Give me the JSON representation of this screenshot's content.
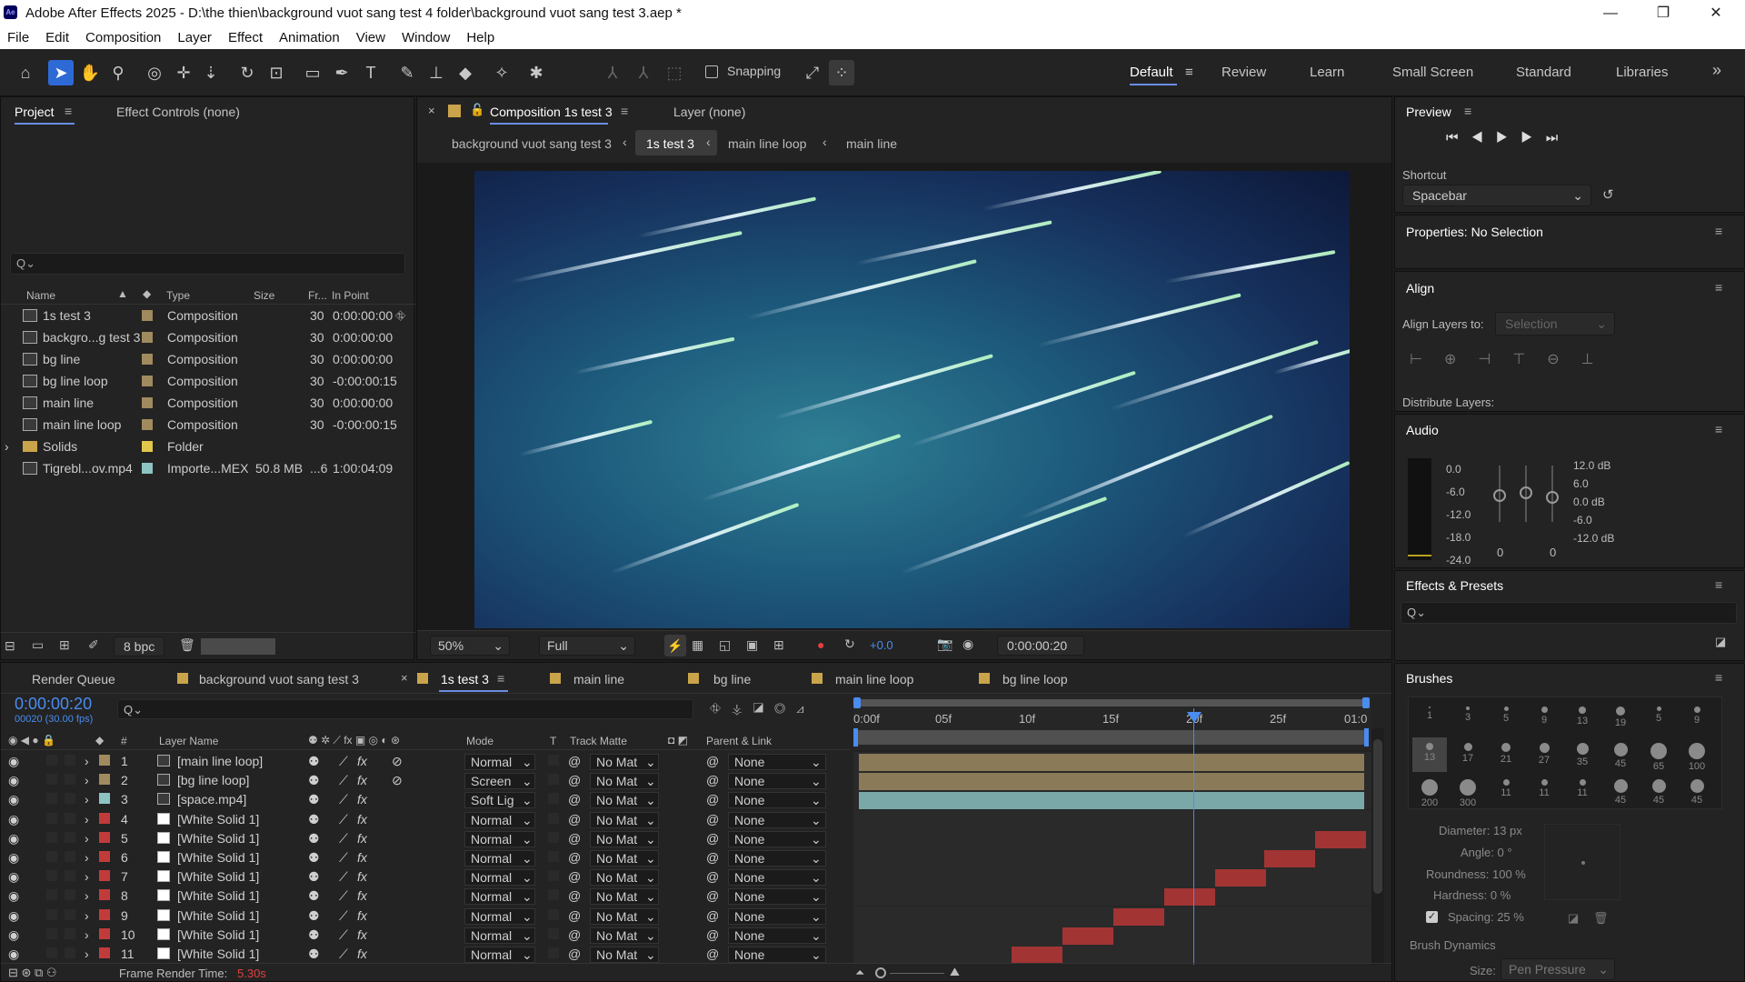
{
  "window": {
    "title": "Adobe After Effects 2025 - D:\\the thien\\background vuot sang test 4 folder\\background vuot sang test 3.aep *",
    "app_icon": "Ae"
  },
  "window_controls": {
    "minimize": "—",
    "maximize": "❐",
    "close": "✕"
  },
  "menu": [
    "File",
    "Edit",
    "Composition",
    "Layer",
    "Effect",
    "Animation",
    "View",
    "Window",
    "Help"
  ],
  "toolbar": {
    "snapping": "Snapping",
    "workspaces": [
      "Default",
      "Review",
      "Learn",
      "Small Screen",
      "Standard",
      "Libraries"
    ],
    "more": "»"
  },
  "project": {
    "tab": "Project",
    "tab2": "Effect Controls (none)",
    "search_placeholder": "Q⌄",
    "columns": [
      "Name",
      "Type",
      "Size",
      "Fr...",
      "In Point"
    ],
    "items": [
      {
        "name": "1s test 3",
        "type": "Composition",
        "size": "",
        "fr": "30",
        "in": "0:00:00:00",
        "color": "#a08a5e"
      },
      {
        "name": "backgro...g test 3",
        "type": "Composition",
        "size": "",
        "fr": "30",
        "in": "0:00:00:00",
        "color": "#a08a5e"
      },
      {
        "name": "bg line",
        "type": "Composition",
        "size": "",
        "fr": "30",
        "in": "0:00:00:00",
        "color": "#a08a5e"
      },
      {
        "name": "bg line loop",
        "type": "Composition",
        "size": "",
        "fr": "30",
        "in": "-0:00:00:15",
        "color": "#a08a5e"
      },
      {
        "name": "main line",
        "type": "Composition",
        "size": "",
        "fr": "30",
        "in": "0:00:00:00",
        "color": "#a08a5e"
      },
      {
        "name": "main line loop",
        "type": "Composition",
        "size": "",
        "fr": "30",
        "in": "-0:00:00:15",
        "color": "#a08a5e"
      },
      {
        "name": "Solids",
        "type": "Folder",
        "size": "",
        "fr": "",
        "in": "",
        "color": "#e2c84a"
      },
      {
        "name": "Tigrebl...ov.mp4",
        "type": "Importe...MEX",
        "size": "50.8 MB",
        "fr": "...6",
        "in": "1:00:04:09",
        "color": "#8ec3c3"
      }
    ],
    "bpc": "8 bpc"
  },
  "composition": {
    "tab": "Composition 1s test 3",
    "layer_tab": "Layer (none)",
    "breadcrumbs": [
      "background vuot sang test 3",
      "1s test 3",
      "main line loop",
      "main line"
    ],
    "zoom": "50%",
    "resolution": "Full",
    "exposure": "+0.0",
    "timecode": "0:00:00:20"
  },
  "preview": {
    "title": "Preview",
    "shortcut_label": "Shortcut",
    "shortcut": "Spacebar"
  },
  "properties": {
    "title": "Properties: No Selection"
  },
  "align": {
    "title": "Align",
    "align_to_label": "Align Layers to:",
    "align_to": "Selection",
    "distribute": "Distribute Layers:"
  },
  "audio": {
    "title": "Audio",
    "left_scale": [
      "0.0",
      "-6.0",
      "-12.0",
      "-18.0",
      "-24.0"
    ],
    "right_scale": [
      "12.0 dB",
      "6.0",
      "0.0 dB",
      "-6.0",
      "-12.0 dB"
    ],
    "knob_values": [
      "0",
      "0"
    ]
  },
  "effects": {
    "title": "Effects & Presets",
    "search": "Q⌄"
  },
  "brushes": {
    "title": "Brushes",
    "sizes": [
      [
        "1",
        "3",
        "5",
        "9",
        "13",
        "19",
        "5",
        "9"
      ],
      [
        "13",
        "17",
        "21",
        "27",
        "35",
        "45",
        "65",
        "100"
      ],
      [
        "200",
        "300",
        "11",
        "11",
        "11",
        "45",
        "45",
        "45"
      ]
    ],
    "diameter": "Diameter: 13 px",
    "angle": "Angle: 0 °",
    "roundness": "Roundness: 100 %",
    "hardness": "Hardness: 0 %",
    "spacing": "Spacing: 25 %",
    "dynamics": "Brush Dynamics",
    "size_label": "Size:",
    "size_value": "Pen Pressure"
  },
  "timeline": {
    "tabs": [
      "Render Queue",
      "background vuot sang test 3",
      "1s test 3",
      "main line",
      "bg line",
      "main line loop",
      "bg line loop"
    ],
    "timecode": "0:00:00:20",
    "fps": "00020 (30.00 fps)",
    "columns": {
      "layer_name": "Layer Name",
      "mode": "Mode",
      "t": "T",
      "matte": "Track Matte",
      "parent": "Parent & Link",
      "num": "#"
    },
    "ruler": [
      "0:00f",
      "05f",
      "10f",
      "15f",
      "20f",
      "25f",
      "01:0"
    ],
    "layers": [
      {
        "num": "1",
        "name": "[main line loop]",
        "mode": "Normal",
        "matte": "No Mat",
        "parent": "None",
        "color": "#a08a5e"
      },
      {
        "num": "2",
        "name": "[bg line loop]",
        "mode": "Screen",
        "matte": "No Mat",
        "parent": "None",
        "color": "#a08a5e"
      },
      {
        "num": "3",
        "name": "[space.mp4]",
        "mode": "Soft Lig",
        "matte": "No Mat",
        "parent": "None",
        "color": "#8ec3c3"
      },
      {
        "num": "4",
        "name": "[White Solid 1]",
        "mode": "Normal",
        "matte": "No Mat",
        "parent": "None",
        "color": "#c23b3b"
      },
      {
        "num": "5",
        "name": "[White Solid 1]",
        "mode": "Normal",
        "matte": "No Mat",
        "parent": "None",
        "color": "#c23b3b"
      },
      {
        "num": "6",
        "name": "[White Solid 1]",
        "mode": "Normal",
        "matte": "No Mat",
        "parent": "None",
        "color": "#c23b3b"
      },
      {
        "num": "7",
        "name": "[White Solid 1]",
        "mode": "Normal",
        "matte": "No Mat",
        "parent": "None",
        "color": "#c23b3b"
      },
      {
        "num": "8",
        "name": "[White Solid 1]",
        "mode": "Normal",
        "matte": "No Mat",
        "parent": "None",
        "color": "#c23b3b"
      },
      {
        "num": "9",
        "name": "[White Solid 1]",
        "mode": "Normal",
        "matte": "No Mat",
        "parent": "None",
        "color": "#c23b3b"
      },
      {
        "num": "10",
        "name": "[White Solid 1]",
        "mode": "Normal",
        "matte": "No Mat",
        "parent": "None",
        "color": "#c23b3b"
      },
      {
        "num": "11",
        "name": "[White Solid 1]",
        "mode": "Normal",
        "matte": "No Mat",
        "parent": "None",
        "color": "#c23b3b"
      }
    ],
    "frame_render_label": "Frame Render Time:",
    "frame_render_value": "5.30s"
  }
}
